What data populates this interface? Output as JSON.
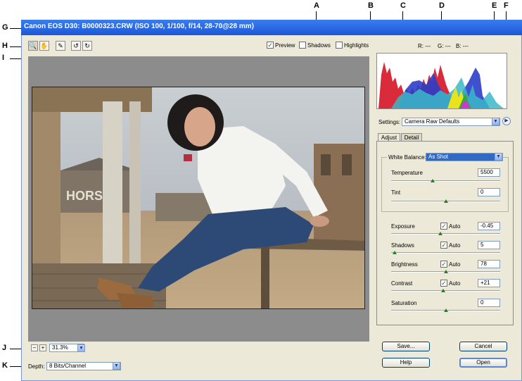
{
  "window": {
    "title": "Canon EOS D30:  B0000323.CRW  (ISO 100, 1/100, f/14, 28-70@28 mm)"
  },
  "callouts": [
    "A",
    "B",
    "C",
    "D",
    "E",
    "F",
    "G",
    "H",
    "I",
    "J",
    "K"
  ],
  "toolbar": {
    "tools": [
      {
        "name": "zoom-tool-icon",
        "glyph": "🔍"
      },
      {
        "name": "hand-tool-icon",
        "glyph": "✋"
      },
      {
        "name": "eyedropper-tool-icon",
        "glyph": "✎"
      },
      {
        "name": "rotate-left-icon",
        "glyph": "↺"
      },
      {
        "name": "rotate-right-icon",
        "glyph": "↻"
      }
    ]
  },
  "view_options": {
    "preview_label": "Preview",
    "preview_checked": true,
    "shadows_label": "Shadows",
    "shadows_checked": false,
    "highlights_label": "Highlights",
    "highlights_checked": false
  },
  "rgb_readout": {
    "r": "R: ---",
    "g": "G: ---",
    "b": "B: ---"
  },
  "settings": {
    "label": "Settings:",
    "value": "Camera Raw Defaults"
  },
  "tabs": [
    {
      "label": "Adjust",
      "active": true
    },
    {
      "label": "Detail",
      "active": false
    }
  ],
  "adjust": {
    "white_balance_label": "White Balance:",
    "white_balance_value": "As Shot",
    "temperature_label": "Temperature",
    "temperature_value": "5500",
    "temperature_level": 0.38,
    "tint_label": "Tint",
    "tint_value": "0",
    "tint_level": 0.5,
    "exposure_label": "Exposure",
    "exposure_auto": "Auto",
    "exposure_value": "-0.45",
    "exposure_level": 0.45,
    "shadows_label": "Shadows",
    "shadows_auto": "Auto",
    "shadows_value": "5",
    "shadows_level": 0.03,
    "brightness_label": "Brightness",
    "brightness_auto": "Auto",
    "brightness_value": "78",
    "brightness_level": 0.5,
    "contrast_label": "Contrast",
    "contrast_auto": "Auto",
    "contrast_value": "+21",
    "contrast_level": 0.48,
    "saturation_label": "Saturation",
    "saturation_value": "0",
    "saturation_level": 0.5
  },
  "zoom": {
    "value": "31.3%"
  },
  "depth": {
    "label": "Depth:",
    "value": "8 Bits/Channel"
  },
  "buttons": {
    "save": "Save...",
    "cancel": "Cancel",
    "help": "Help",
    "open": "Open"
  },
  "photo": {
    "sign_text": "HORS"
  },
  "colors": {
    "title_bar": "#1c56d6",
    "dialog_bg": "#ece9d8",
    "preview_bg": "#8c8c8c",
    "checkmark": "#1d6e1d",
    "slider_thumb": "#2f7a2f"
  }
}
